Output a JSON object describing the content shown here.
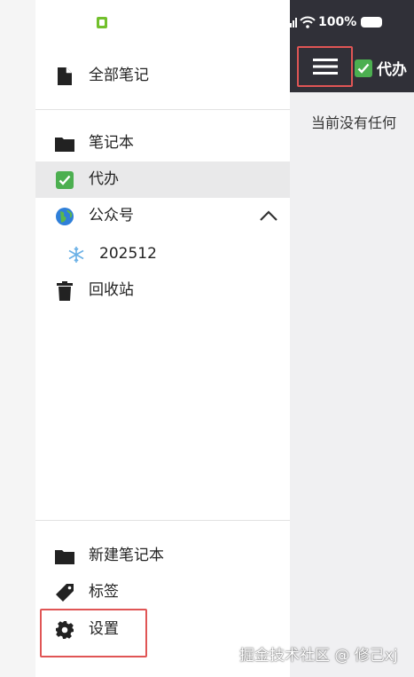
{
  "status_bar": {
    "battery": "100%"
  },
  "drawer": {
    "items_top": [
      {
        "label": "全部笔记",
        "icon": "note-icon"
      }
    ],
    "items": [
      {
        "label": "笔记本",
        "icon": "folder-icon"
      },
      {
        "label": "代办",
        "icon": "check-icon",
        "active": true
      },
      {
        "label": "公众号",
        "icon": "globe-icon",
        "expanded": true
      },
      {
        "label": "202512",
        "icon": "snowflake-icon"
      },
      {
        "label": "回收站",
        "icon": "trash-icon"
      }
    ],
    "items_bottom": [
      {
        "label": "新建笔记本",
        "icon": "folder-icon"
      },
      {
        "label": "标签",
        "icon": "tag-icon"
      },
      {
        "label": "设置",
        "icon": "gear-icon"
      }
    ]
  },
  "main": {
    "title": "代办",
    "empty_text": "当前没有任何"
  },
  "watermark": "掘金技术社区 @ 修己xj",
  "colors": {
    "appbar": "#303038",
    "highlight": "#e05555",
    "active_row": "#e9e9ea",
    "check_green": "#4caf50"
  }
}
